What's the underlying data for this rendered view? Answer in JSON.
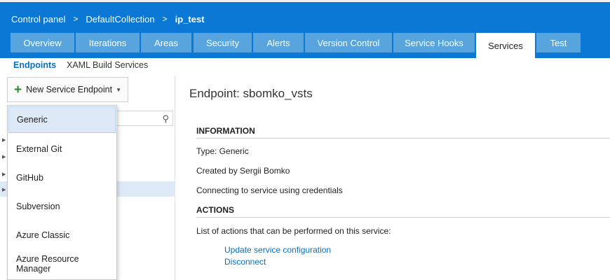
{
  "breadcrumb": [
    "Control panel",
    "DefaultCollection",
    "ip_test"
  ],
  "tabs": [
    {
      "label": "Overview",
      "active": false
    },
    {
      "label": "Iterations",
      "active": false
    },
    {
      "label": "Areas",
      "active": false
    },
    {
      "label": "Security",
      "active": false
    },
    {
      "label": "Alerts",
      "active": false
    },
    {
      "label": "Version Control",
      "active": false
    },
    {
      "label": "Service Hooks",
      "active": false
    },
    {
      "label": "Services",
      "active": true
    },
    {
      "label": "Test",
      "active": false
    }
  ],
  "subnav": {
    "endpoints": "Endpoints",
    "xaml": "XAML Build Services"
  },
  "toolbar": {
    "new_endpoint": "New Service Endpoint"
  },
  "dropdown": {
    "items": [
      "Generic",
      "External Git",
      "GitHub",
      "Subversion",
      "Azure Classic",
      "Azure Resource Manager"
    ]
  },
  "detail": {
    "title": "Endpoint: sbomko_vsts",
    "information_header": "INFORMATION",
    "type": "Type: Generic",
    "created_by": "Created by Sergii Bomko",
    "connecting": "Connecting to service using credentials",
    "actions_header": "ACTIONS",
    "actions_intro": "List of actions that can be performed on this service:",
    "update_link": "Update service configuration",
    "disconnect_link": "Disconnect"
  },
  "colors": {
    "accent": "#0a78d4",
    "tab": "#57a4df",
    "link": "#0a6fc2",
    "selection": "#dde9f7"
  }
}
